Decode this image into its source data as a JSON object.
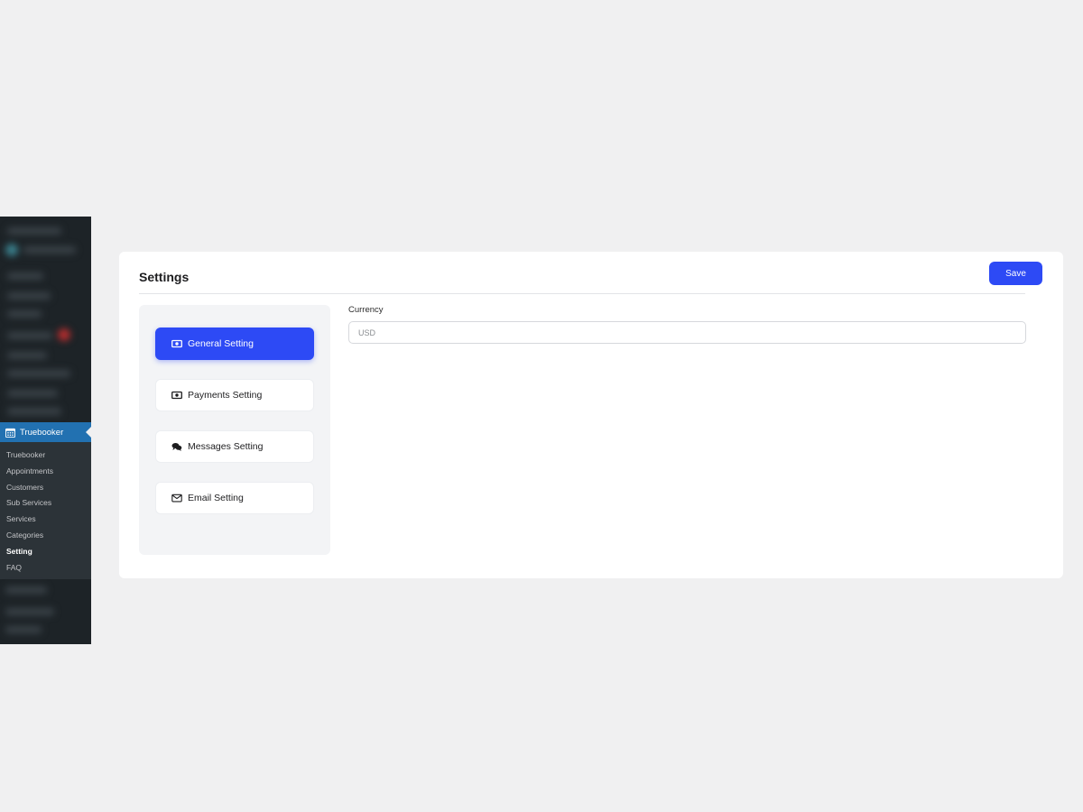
{
  "sidebar": {
    "menu_title": "Truebooker",
    "items": [
      {
        "label": "Truebooker",
        "active": false
      },
      {
        "label": "Appointments",
        "active": false
      },
      {
        "label": "Customers",
        "active": false
      },
      {
        "label": "Sub Services",
        "active": false
      },
      {
        "label": "Services",
        "active": false
      },
      {
        "label": "Categories",
        "active": false
      },
      {
        "label": "Setting",
        "active": true
      },
      {
        "label": "FAQ",
        "active": false
      }
    ]
  },
  "settings": {
    "title": "Settings",
    "save_label": "Save",
    "tabs": [
      {
        "label": "General Setting",
        "icon": "money-icon",
        "active": true
      },
      {
        "label": "Payments Setting",
        "icon": "money-icon",
        "active": false
      },
      {
        "label": "Messages Setting",
        "icon": "chat-icon",
        "active": false
      },
      {
        "label": "Email Setting",
        "icon": "envelope-icon",
        "active": false
      }
    ],
    "currency": {
      "label": "Currency",
      "value": "",
      "placeholder": "USD"
    }
  },
  "colors": {
    "accent": "#2d4af5",
    "wp_sidebar": "#1d2327",
    "wp_submenu": "#2c3338",
    "wp_highlight": "#2271b1"
  }
}
